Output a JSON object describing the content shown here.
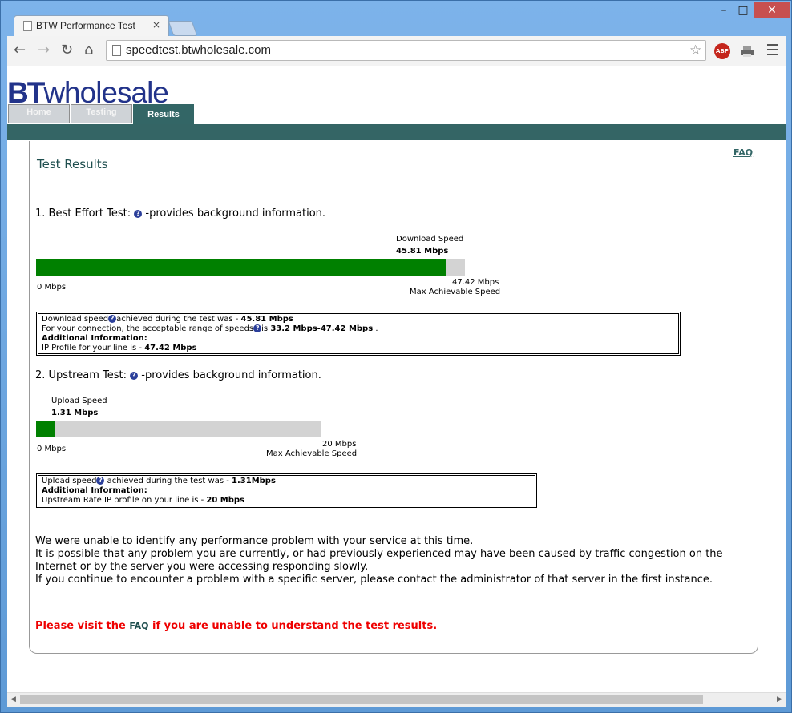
{
  "browser": {
    "tab_title": "BTW Performance Test",
    "tab_close": "×",
    "url": "speedtest.btwholesale.com",
    "window_min": "–",
    "window_max": "□",
    "window_close": "✕",
    "abp_label": "ABP"
  },
  "page": {
    "logo_bt": "BT",
    "logo_rest": "wholesale",
    "nav": [
      {
        "label": "Home"
      },
      {
        "label": "Testing"
      },
      {
        "label": "Results"
      }
    ],
    "faq_link": "FAQ",
    "heading": "Test Results",
    "best_effort": {
      "title": "1. Best Effort Test:",
      "desc": "-provides background information.",
      "speed_caption": "Download Speed",
      "speed_value": "45.81 Mbps",
      "min_label": "0 Mbps",
      "max_value": "47.42 Mbps",
      "max_caption": "Max Achievable Speed",
      "fill_fraction": 0.955,
      "info": {
        "line1_a": "Download speed",
        "line1_b": "achieved during the test was - ",
        "line1_value": "45.81 Mbps",
        "line2_a": "For your connection, the acceptable range of speeds",
        "line2_b": "is ",
        "line2_value": "33.2 Mbps-47.42 Mbps",
        "line2_end": " .",
        "additional": "Additional Information:",
        "line4_a": "IP Profile for your line is - ",
        "line4_value": "47.42 Mbps"
      }
    },
    "upstream": {
      "title": "2. Upstream Test:",
      "desc": "-provides background information.",
      "speed_caption": "Upload Speed",
      "speed_value": "1.31 Mbps",
      "min_label": "0 Mbps",
      "max_value": "20 Mbps",
      "max_caption": "Max Achievable Speed",
      "fill_fraction": 0.0655,
      "info": {
        "line1_a": "Upload speed",
        "line1_b": " achieved during the test was - ",
        "line1_value": "1.31Mbps",
        "additional": "Additional Information:",
        "line3_a": "Upstream Rate IP profile on your line is - ",
        "line3_value": "20 Mbps"
      }
    },
    "message": [
      "We were unable to identify any performance problem with your service at this time.",
      "It is possible that any problem you are currently, or had previously experienced may have been caused by traffic congestion on the",
      "Internet or by the server you were accessing responding slowly.",
      "If you continue to encounter a problem with a specific server, please contact the administrator of that server in the first instance."
    ],
    "visit": {
      "before": "Please visit the ",
      "link": "FAQ",
      "after": " if you are unable to understand the test results."
    }
  },
  "colors": {
    "bar_fill": "#008000",
    "bar_track": "#d3d3d3",
    "teal": "#336666",
    "warning": "#ee0000"
  },
  "icons": {
    "back": "arrow-left-icon",
    "forward": "arrow-right-icon",
    "reload": "reload-icon",
    "home": "home-icon",
    "bookmark": "star-icon",
    "help": "question-icon",
    "menu": "hamburger-icon"
  }
}
